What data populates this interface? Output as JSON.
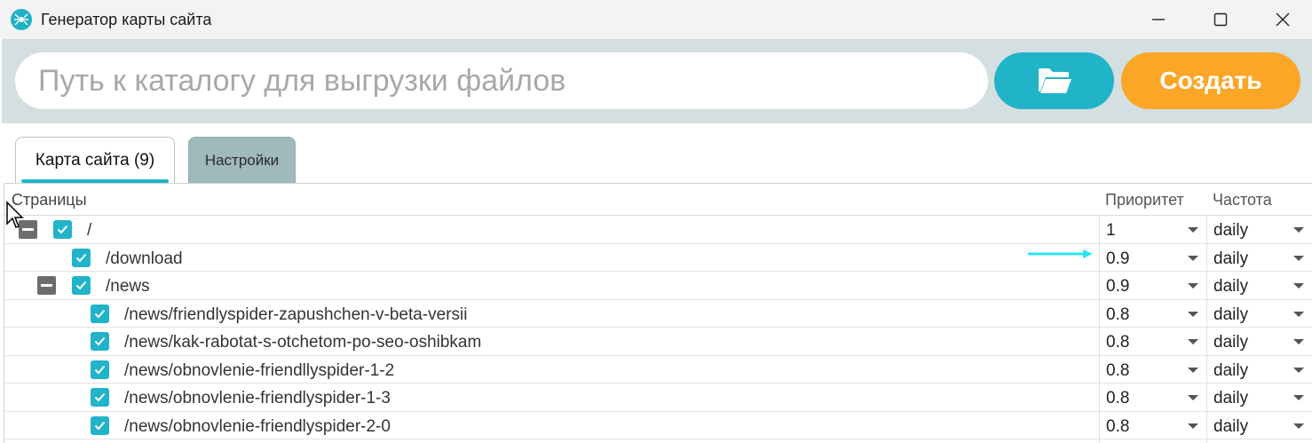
{
  "window": {
    "title": "Генератор карты сайта",
    "app_icon": "spider-logo-icon",
    "controls": [
      "minimize-icon",
      "maximize-icon",
      "close-icon"
    ]
  },
  "toolbar": {
    "path_placeholder": "Путь к каталогу для выгрузки файлов",
    "path_value": "",
    "folder_icon": "folder-open-icon",
    "create_label": "Создать"
  },
  "tabs": [
    {
      "label": "Карта сайта (9)",
      "active": true
    },
    {
      "label": "Настройки",
      "active": false
    }
  ],
  "grid": {
    "columns": {
      "pages": "Страницы",
      "priority": "Приоритет",
      "frequency": "Частота"
    },
    "rows": [
      {
        "path": "/",
        "priority": "1",
        "frequency": "daily",
        "checked": true,
        "expander": "collapse"
      },
      {
        "path": "/download",
        "priority": "0.9",
        "frequency": "daily",
        "checked": true,
        "expander": null
      },
      {
        "path": "/news",
        "priority": "0.9",
        "frequency": "daily",
        "checked": true,
        "expander": "collapse"
      },
      {
        "path": "/news/friendlyspider-zapushchen-v-beta-versii",
        "priority": "0.8",
        "frequency": "daily",
        "checked": true,
        "expander": null
      },
      {
        "path": "/news/kak-rabotat-s-otchetom-po-seo-oshibkam",
        "priority": "0.8",
        "frequency": "daily",
        "checked": true,
        "expander": null
      },
      {
        "path": "/news/obnovlenie-friendllyspider-1-2",
        "priority": "0.8",
        "frequency": "daily",
        "checked": true,
        "expander": null
      },
      {
        "path": "/news/obnovlenie-friendlyspider-1-3",
        "priority": "0.8",
        "frequency": "daily",
        "checked": true,
        "expander": null
      },
      {
        "path": "/news/obnovlenie-friendlyspider-2-0",
        "priority": "0.8",
        "frequency": "daily",
        "checked": true,
        "expander": null
      }
    ]
  },
  "colors": {
    "accent": "#21b4c8",
    "create_button": "#fba626",
    "toolbar_background": "#d3dfe0",
    "inactive_tab": "#9fb9bd"
  }
}
